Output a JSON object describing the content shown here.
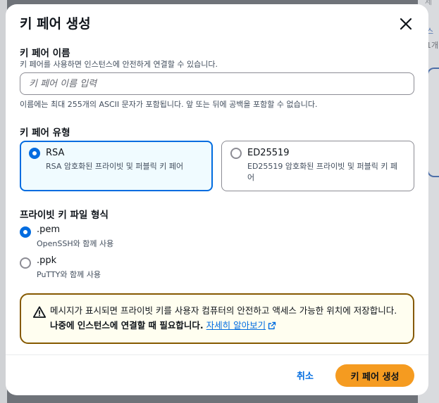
{
  "background": {
    "right_text_1": "세",
    "right_link": "스",
    "right_text_2": "1개"
  },
  "modal": {
    "title": "키 페어 생성",
    "close_icon": "close-icon"
  },
  "key_pair_name": {
    "label": "키 페어 이름",
    "description": "키 페어를 사용하면 인스턴스에 안전하게 연결할 수 있습니다.",
    "placeholder": "키 페어 이름 입력",
    "value": "",
    "hint": "이름에는 최대 255개의 ASCII 문자가 포함됩니다. 앞 또는 뒤에 공백을 포함할 수 없습니다."
  },
  "key_pair_type": {
    "label": "키 페어 유형",
    "options": [
      {
        "title": "RSA",
        "description": "RSA 암호화된 프라이빗 및 퍼블릭 키 페어",
        "selected": true
      },
      {
        "title": "ED25519",
        "description": "ED25519 암호화된 프라이빗 및 퍼블릭 키 페어",
        "selected": false
      }
    ]
  },
  "private_key_format": {
    "label": "프라이빗 키 파일 형식",
    "options": [
      {
        "title": ".pem",
        "description": "OpenSSH와 함께 사용",
        "selected": true
      },
      {
        "title": ".ppk",
        "description": "PuTTY와 함께 사용",
        "selected": false
      }
    ]
  },
  "warning": {
    "icon": "warning-icon",
    "text": "메시지가 표시되면 프라이빗 키를 사용자 컴퓨터의 안전하고 액세스 가능한 위치에 저장합니다. ",
    "strong": "나중에 인스턴스에 연결할 때 필요합니다.",
    "link": "자세히 알아보기",
    "link_icon": "external-link-icon"
  },
  "footer": {
    "cancel_label": "취소",
    "create_label": "키 페어 생성"
  },
  "colors": {
    "accent": "#006ce0",
    "primary_button": "#f59b20",
    "warning_border": "#855900"
  }
}
